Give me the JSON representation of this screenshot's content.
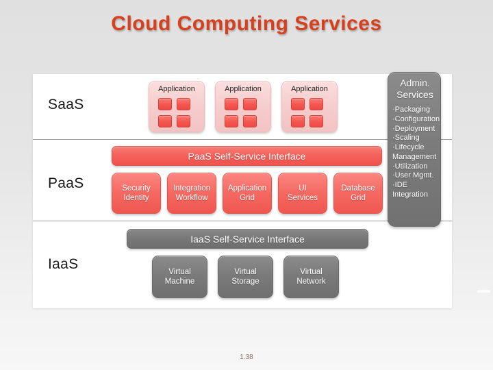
{
  "slide": {
    "title": "Cloud Computing Services",
    "title_color": "#d6401e",
    "page_number": "1.38",
    "background_color": "#e3e3e3",
    "panel_color": "#ffffff"
  },
  "diagram": {
    "accent_red": "#f4605a",
    "accent_gray": "#787878",
    "layers": [
      {
        "id": "saas",
        "label": "SaaS",
        "apps": [
          {
            "title": "Application",
            "squares": 4
          },
          {
            "title": "Application",
            "squares": 4
          },
          {
            "title": "Application",
            "squares": 4
          }
        ]
      },
      {
        "id": "paas",
        "label": "PaaS",
        "interface_bar": "PaaS Self-Service Interface",
        "tiles": [
          {
            "line1": "Security",
            "line2": "Identity"
          },
          {
            "line1": "Integration",
            "line2": "Workflow"
          },
          {
            "line1": "Application",
            "line2": "Grid"
          },
          {
            "line1": "UI",
            "line2": "Services"
          },
          {
            "line1": "Database",
            "line2": "Grid"
          }
        ]
      },
      {
        "id": "iaas",
        "label": "IaaS",
        "interface_bar": "IaaS Self-Service Interface",
        "tiles": [
          {
            "line1": "Virtual",
            "line2": "Machine"
          },
          {
            "line1": "Virtual",
            "line2": "Storage"
          },
          {
            "line1": "Virtual",
            "line2": "Network"
          }
        ]
      }
    ],
    "admin": {
      "title_line1": "Admin.",
      "title_line2": "Services",
      "items": [
        "·Packaging",
        "·Configuration",
        "·Deployment",
        "·Scaling",
        "·Lifecycle",
        "Management",
        "·Utilization",
        "·User Mgmt.",
        "·IDE",
        "Integration"
      ]
    }
  }
}
